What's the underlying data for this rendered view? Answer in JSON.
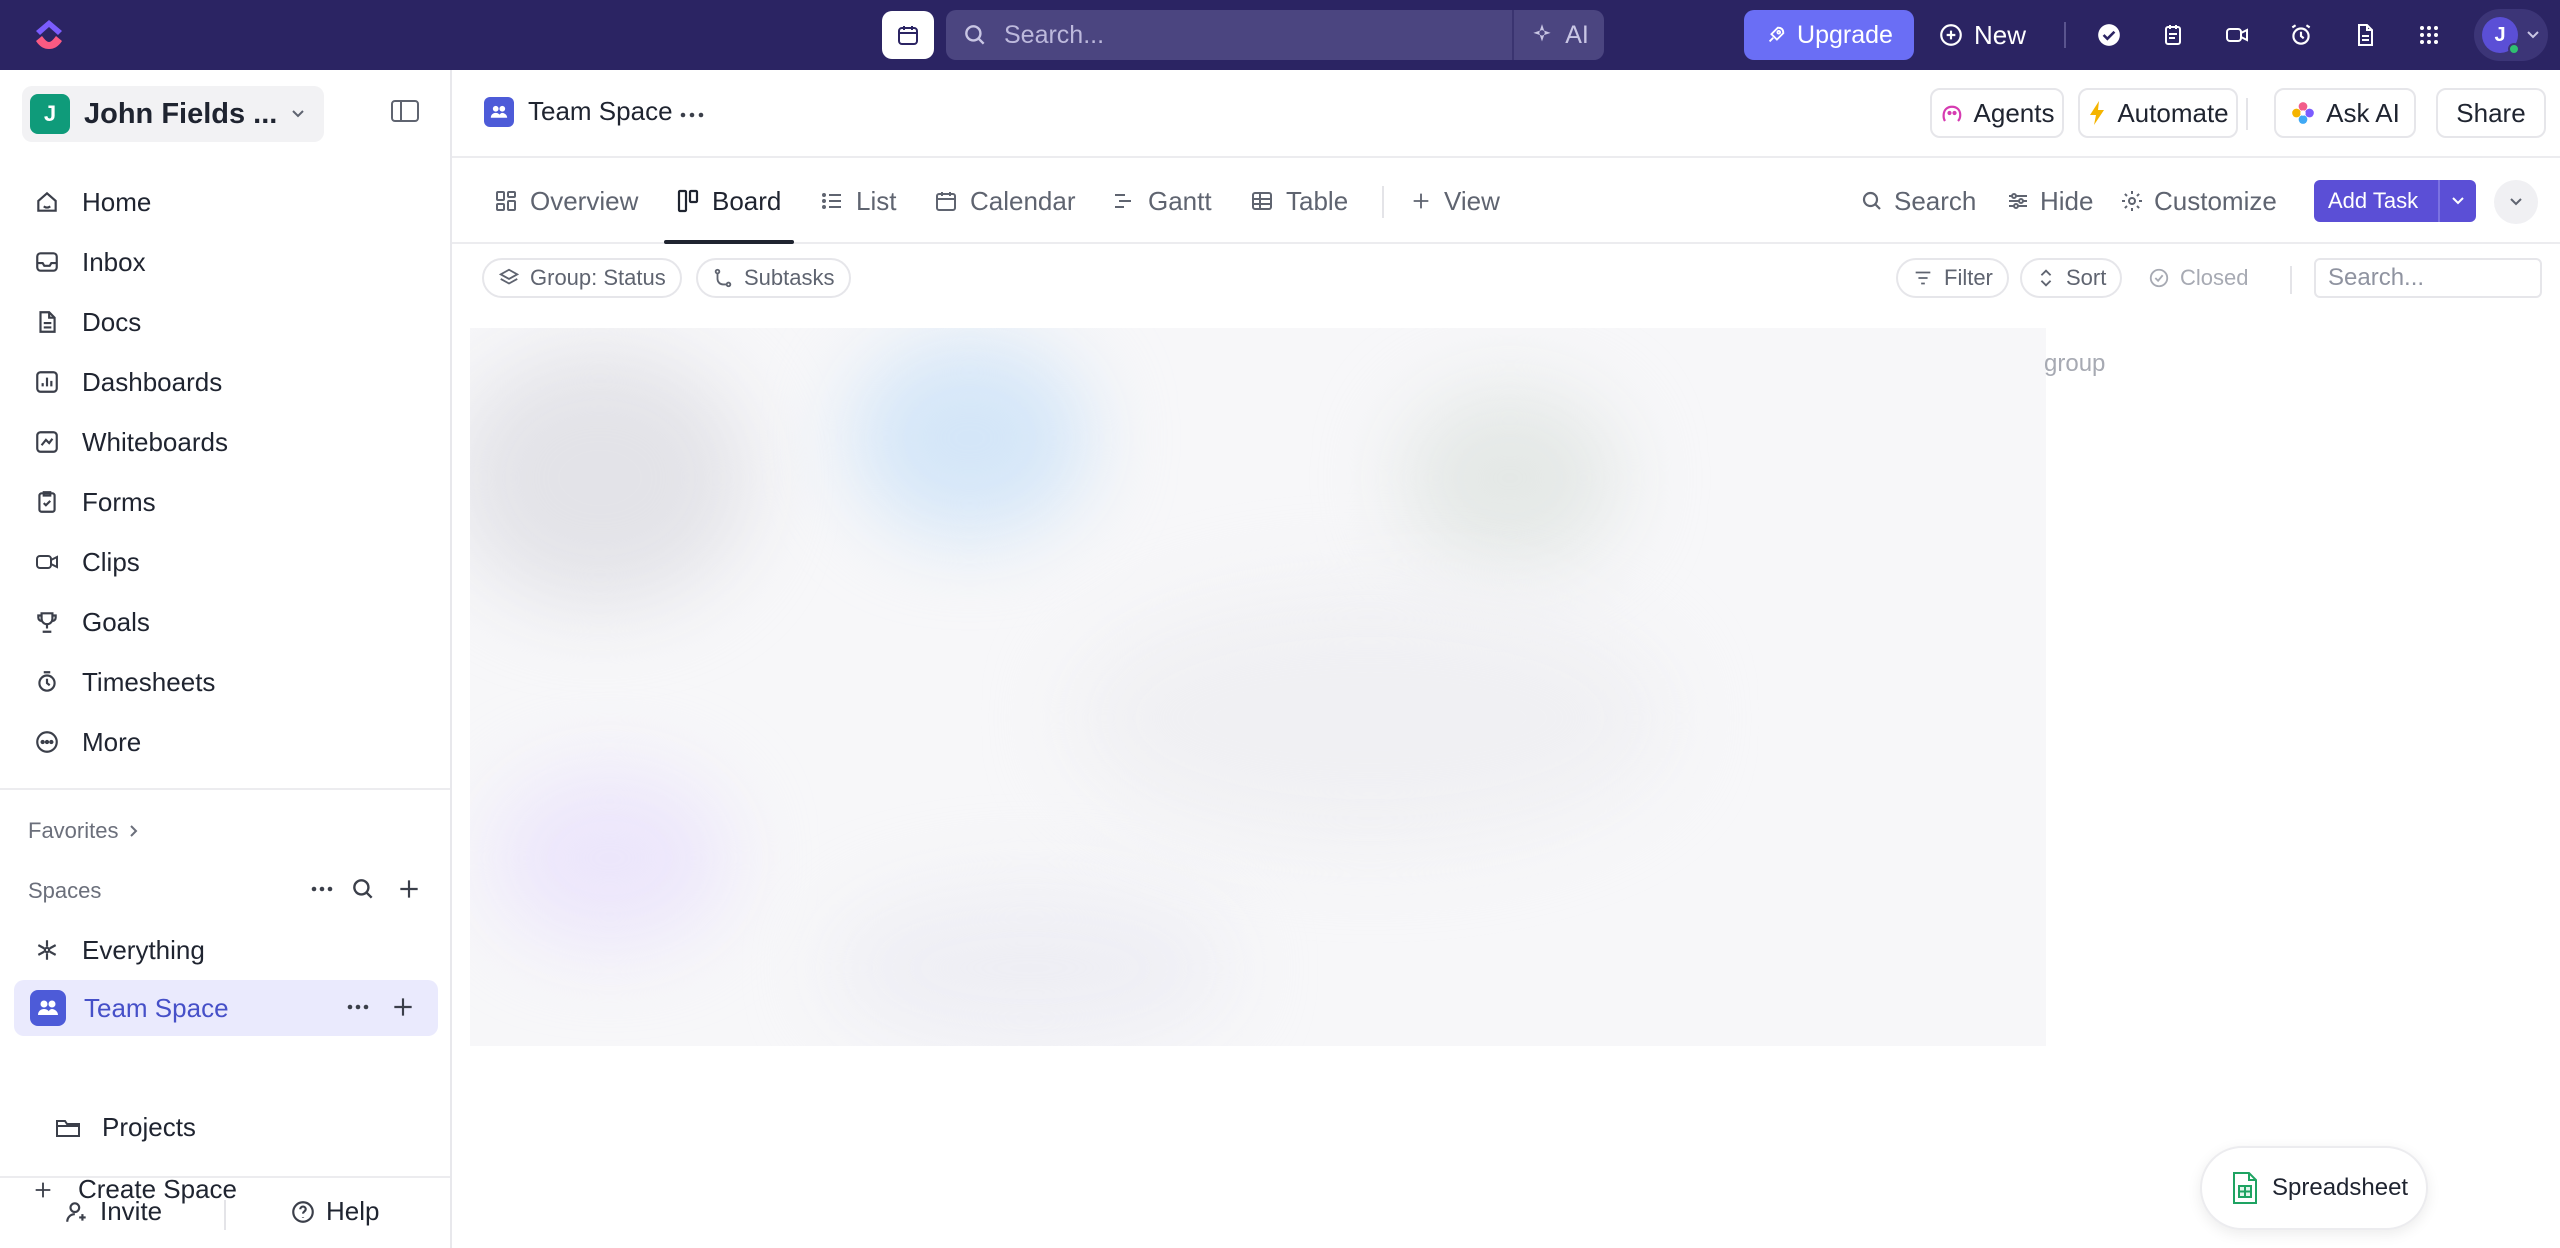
{
  "topbar": {
    "search_placeholder": "Search...",
    "ai_label": "AI",
    "upgrade_label": "Upgrade",
    "new_label": "New",
    "user_initial": "J",
    "brand_color": "#2b2463",
    "accent_color": "#6a6ef5"
  },
  "sidebar": {
    "workspace_initial": "J",
    "workspace_name": "John Fields ...",
    "nav": [
      {
        "label": "Home",
        "icon": "home-icon"
      },
      {
        "label": "Inbox",
        "icon": "inbox-icon"
      },
      {
        "label": "Docs",
        "icon": "docs-icon"
      },
      {
        "label": "Dashboards",
        "icon": "dashboards-icon"
      },
      {
        "label": "Whiteboards",
        "icon": "whiteboards-icon"
      },
      {
        "label": "Forms",
        "icon": "forms-icon"
      },
      {
        "label": "Clips",
        "icon": "clips-icon"
      },
      {
        "label": "Goals",
        "icon": "goals-icon"
      },
      {
        "label": "Timesheets",
        "icon": "timesheets-icon"
      },
      {
        "label": "More",
        "icon": "more-icon"
      }
    ],
    "favorites_label": "Favorites",
    "spaces_label": "Spaces",
    "everything_label": "Everything",
    "team_space_label": "Team Space",
    "projects_label": "Projects",
    "create_space_label": "Create Space",
    "invite_label": "Invite",
    "help_label": "Help"
  },
  "header": {
    "space_name": "Team Space",
    "agents_label": "Agents",
    "automate_label": "Automate",
    "ask_ai_label": "Ask AI",
    "share_label": "Share"
  },
  "views": {
    "tabs": [
      {
        "label": "Overview",
        "icon": "overview-icon",
        "active": false
      },
      {
        "label": "Board",
        "icon": "board-icon",
        "active": true
      },
      {
        "label": "List",
        "icon": "list-icon",
        "active": false
      },
      {
        "label": "Calendar",
        "icon": "calendar-icon",
        "active": false
      },
      {
        "label": "Gantt",
        "icon": "gantt-icon",
        "active": false
      },
      {
        "label": "Table",
        "icon": "table-icon",
        "active": false
      }
    ],
    "add_view_label": "View",
    "search_label": "Search",
    "hide_label": "Hide",
    "customize_label": "Customize",
    "add_task_label": "Add Task"
  },
  "filters": {
    "group_label": "Group: Status",
    "subtasks_label": "Subtasks",
    "filter_label": "Filter",
    "sort_label": "Sort",
    "closed_label": "Closed",
    "search_placeholder": "Search..."
  },
  "board": {
    "group_hint": "group"
  },
  "floating": {
    "spreadsheet_label": "Spreadsheet"
  }
}
